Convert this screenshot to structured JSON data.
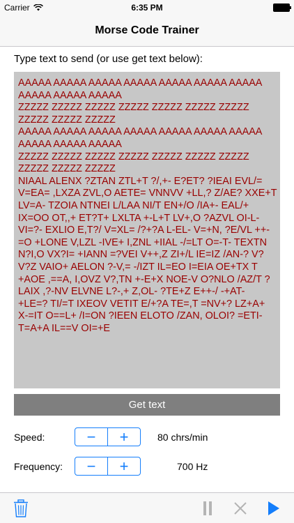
{
  "status_bar": {
    "carrier": "Carrier",
    "time": "6:35 PM"
  },
  "nav": {
    "title": "Morse Code Trainer"
  },
  "prompt": "Type text to send (or use get text below):",
  "text_area": {
    "value": "AAAAA AAAAA AAAAA AAAAA AAAAA AAAAA AAAAA\nAAAAA AAAAA AAAAA\nZZZZZ ZZZZZ ZZZZZ ZZZZZ ZZZZZ ZZZZZ ZZZZZ\nZZZZZ ZZZZZ ZZZZZ\nAAAAA AAAAA AAAAA AAAAA AAAAA AAAAA AAAAA\nAAAAA AAAAA AAAAA\nZZZZZ ZZZZZ ZZZZZ ZZZZZ ZZZZZ ZZZZZ ZZZZZ\nZZZZZ ZZZZZ ZZZZZ\nNIAAL ALENX ?ZTAN ZTL+T ?/,+- E?ET? ?IEAI EVL/=\nV=EA= ,LXZA ZVL,O AETE= VNNVV +LL,? Z/AE? XXE+T\nLV=A- TZOIA NTNEI L/LAA NI/T EN+/O /IA+- EAL/+\nIX=OO OT,,+ ET?T+ LXLTA +-L+T LV+,O ?AZVL OI-L-\nVI=?- EXLIO E,T?/ V=XL= /?+?A L-EL- V=+N, ?E/VL ++-\n=O +LONE V,LZL -IVE+ I,ZNL +IIAL -/=LT O=-T- TEXTN\nN?I,O VX?I= +IANN =?VEI V++,Z ZI+/L IE=IZ /AN-? V?\nV?Z VAIO+ AELON ?-V,= -/IZT IL=EO I=EIA OE+TX T\n+AOE ,==A, I,OVZ V?,TN +-E+X NOE-V O?NLO /AZ/T ?\nLAIX ,?-NV ELVNE L?-,+ Z,OL- ?TE+Z E++-/ -+AT-\n+LE=? TI/=T IXEOV VETIT E/+?A TE=,T =NV+? LZ+A+\nX-=IT O==L+ /I=ON ?IEEN ELOTO /ZAN, OLOI? =ETI-\nT=A+A IL==V OI=+E"
  },
  "get_text_button": "Get text",
  "speed": {
    "label": "Speed:",
    "value": "80 chrs/min"
  },
  "frequency": {
    "label": "Frequency:",
    "value": "700 Hz"
  },
  "stepper_symbols": {
    "minus": "−",
    "plus": "+"
  },
  "icons": {
    "trash": "trash-icon",
    "pause": "pause-icon",
    "stop": "close-icon",
    "play": "play-icon"
  },
  "colors": {
    "tint": "#147efb",
    "text_dark_red": "#990000",
    "text_area_bg": "#c7c7c7",
    "button_bg": "#7f7f7f",
    "disabled_gray": "#b4b4b4"
  }
}
